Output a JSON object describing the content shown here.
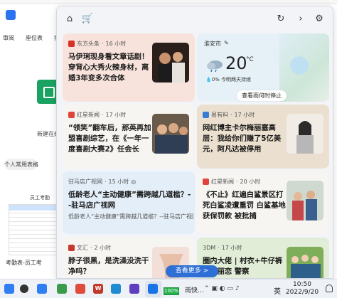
{
  "background_app": {
    "tabs": [
      "审阅",
      "座位表",
      "排班"
    ],
    "new_item_label": "新建在线",
    "common_tables_label": "个人常用表格",
    "staff_label": "员工考勤",
    "sheet_name": "考勤表-员工考"
  },
  "widget": {
    "toolbar": {
      "home_icon": "home-icon",
      "shop_icon": "shop-icon",
      "refresh_icon": "refresh-icon",
      "next_icon": "chevron-right-icon",
      "settings_icon": "gear-icon"
    },
    "weather": {
      "location": "淮安市",
      "temperature": "20",
      "unit": "°C",
      "rain_text": "0%",
      "forecast": "今明两天持续",
      "link": "查看雨何时停止"
    },
    "cards": [
      {
        "source": "东方头条",
        "time": "16 小时",
        "title": "马伊琍现身看文章话剧！穿背心大秀火辣身材，离婚3年变多次合体",
        "color": "#f8e3dc"
      },
      {
        "source": "红星新闻",
        "time": "17 小时",
        "title": "“领笑”翻车后，那英再加盟喜剧综艺，在《一年一度喜剧大赛2》任会长",
        "color": "#f7f5f2"
      },
      {
        "source": "易有料",
        "time": "17 小时",
        "title": "网红博主卡尔梅丽塞高层：我给你们赚了5亿美元，阿凡达被停用",
        "color": "#ebe0cf"
      },
      {
        "source": "驻马店广视网",
        "time": "15 小时",
        "title": "低龄老人“主动健康”需跨越几道槛？--驻马店广视网",
        "desc": "低龄老人“主动健康”需跨越几道槛？--驻马店广视网",
        "color": "#e3eef9"
      },
      {
        "source": "红星新闻",
        "time": "20 小时",
        "title": "《不止》红遍白鲨景区打死白鲨凌遭重罚 白鲨基地获保罚款 被批捕",
        "color": "#f7f5f2"
      },
      {
        "source": "文汇",
        "time": "2 小时",
        "title": "脖子很黑，是洗澡没洗干净吗？",
        "color": "#f7f5f2"
      },
      {
        "source": "3DM",
        "time": "17 小时",
        "title": "圈内大佬 | 村衣+牛仔裤 霍顿丽恋 警察",
        "color": "#e1edd6"
      }
    ],
    "see_more": "查看更多 >"
  },
  "taskbar": {
    "battery": "100%",
    "weather": "雨快…",
    "lang": "英",
    "time": "10:50",
    "date": "2022/9/20"
  }
}
